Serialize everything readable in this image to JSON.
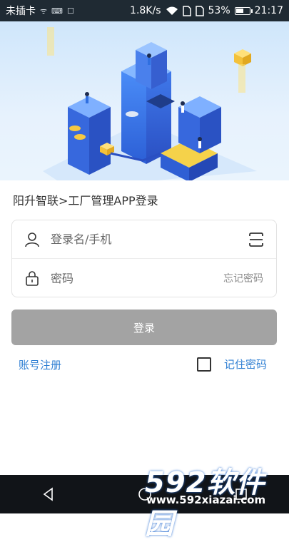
{
  "status": {
    "carrier": "未插卡",
    "speed": "1.8K/s",
    "battery": "53%",
    "battery_level": 0.53,
    "time": "21:17",
    "icons": [
      "wifi-icon",
      "sim-icon",
      "sim-icon",
      "battery-icon"
    ]
  },
  "header": {
    "title": "阳升智联>工厂管理APP登录"
  },
  "form": {
    "username_placeholder": "登录名/手机",
    "password_placeholder": "密码",
    "forgot_label": "忘记密码"
  },
  "actions": {
    "login_label": "登录",
    "register_label": "账号注册",
    "remember_label": "记住密码",
    "remember_checked": false
  },
  "watermark": {
    "big": "592软件园",
    "small": "www.592xiazai.com"
  },
  "colors": {
    "accent": "#2f7fd3",
    "button_disabled": "#a3a3a3",
    "status_bar": "#1f2a33",
    "nav_bar": "#111418"
  }
}
